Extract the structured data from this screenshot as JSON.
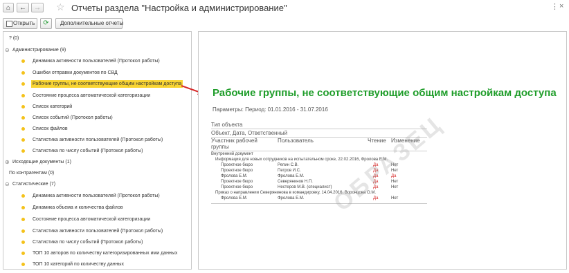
{
  "title": "Отчеты раздела \"Настройка и администрирование\"",
  "toolbar": {
    "open_label": "Открыть",
    "extra_reports_label": "Дополнительные отчеты"
  },
  "tree": {
    "unknown": "? (0)",
    "admin_group": "Администрирование (9)",
    "admin_items": [
      "Динамика активности пользователей (Протокол работы)",
      "Ошибки отправки документов по СВД",
      "Рабочие группы, не соответствующие общим настройкам доступа",
      "Состояние процесса автоматической категоризации",
      "Список категорий",
      "Список событий (Протокол работы)",
      "Список файлов",
      "Статистика активности пользователей (Протокол работы)",
      "Статистика по числу событий (Протокол работы)"
    ],
    "outgoing_group": "Исходящие документы (1)",
    "contractors_group": "По контрагентам (0)",
    "stats_group": "Статистические (7)",
    "stats_items": [
      "Динамика активности пользователей (Протокол работы)",
      "Динамика объема и количества файлов",
      "Состояние процесса автоматической категоризации",
      "Статистика активности пользователей (Протокол работы)",
      "Статистика по числу событий (Протокол работы)",
      "ТОП 10 авторов по количеству категоризированных ими данных",
      "ТОП 10 категорий по количеству данных"
    ]
  },
  "report": {
    "title": "Рабочие группы, не соответствующие общим настройкам доступа",
    "params": "Параметры:   Период: 01.01.2016 - 31.07.2016",
    "header_type": "Тип объекта",
    "header_obj": "Объект, Дата, Ответственный",
    "col_group_1": "Участник рабочей",
    "col_group_2": "группы",
    "col_user": "Пользователь",
    "col_read": "Чтение",
    "col_change": "Изменение",
    "section": "Внутренний документ",
    "doc1": "Информация для новых сотрудников на испытательном сроке, 22.02.2016, Фролова Е.М.",
    "rows1": [
      {
        "group": "Проектное бюро",
        "user": "Репин С.В.",
        "read": "Да",
        "change": "Нет"
      },
      {
        "group": "Проектное бюро",
        "user": "Петров И.С.",
        "read": "Да",
        "change": "Нет"
      },
      {
        "group": "Фролова Е.М.",
        "user": "Фролова Е.М.",
        "read": "Да",
        "change": "Да"
      },
      {
        "group": "Проектное бюро",
        "user": "Северянинов Н.П.",
        "read": "Да",
        "change": "Нет"
      },
      {
        "group": "Проектное бюро",
        "user": "Нестеров М.В. (специалист)",
        "read": "Да",
        "change": "Нет"
      }
    ],
    "doc2": "Приказ о направлении Северянинова в командировку, 14.04.2016, Воронцова О.М.",
    "rows2": [
      {
        "group": "Фролова Е.М.",
        "user": "Фролова Е.М.",
        "read": "Да",
        "change": "Нет"
      }
    ],
    "watermark": "ОБРАЗЕЦ"
  },
  "colors": {
    "accent_green": "#1f9d2a",
    "selection_yellow": "#f9d532",
    "item_dot": "#f4c21b",
    "arrow_red": "#d62828"
  }
}
